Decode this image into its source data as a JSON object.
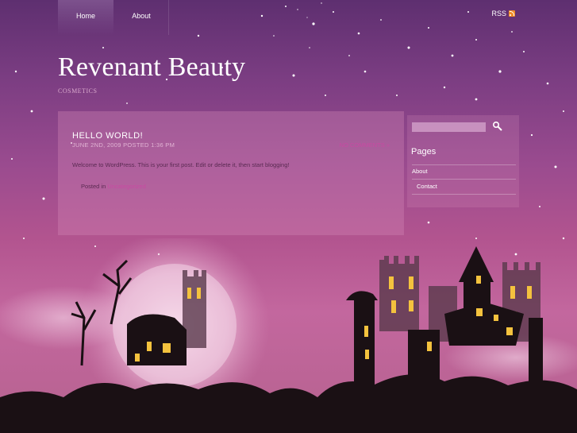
{
  "nav": {
    "items": [
      {
        "label": "Home"
      },
      {
        "label": "About"
      }
    ],
    "rss_label": "RSS"
  },
  "header": {
    "title": "Revenant Beauty",
    "description": "COSMETICS"
  },
  "post": {
    "title": "HELLO WORLD!",
    "meta": "JUNE 2ND, 2009 POSTED 1:36 PM",
    "comments": "NO COMMENTS »",
    "body": "Welcome to WordPress. This is your first post. Edit or delete it, then start blogging!",
    "posted_in": "Posted in",
    "category": "Uncategorized"
  },
  "sidebar": {
    "search_placeholder": "",
    "heading": "Pages",
    "links": [
      {
        "label": "About"
      },
      {
        "label": "Contact"
      }
    ]
  },
  "colors": {
    "accent": "#c84aa2",
    "sky_top": "#5e2f70",
    "sky_bottom": "#c3679e",
    "silhouette": "#1a1014",
    "window_glow": "#f4c23e"
  },
  "icons": {
    "search": "magnifier-icon",
    "rss": "rss-feed-icon"
  }
}
